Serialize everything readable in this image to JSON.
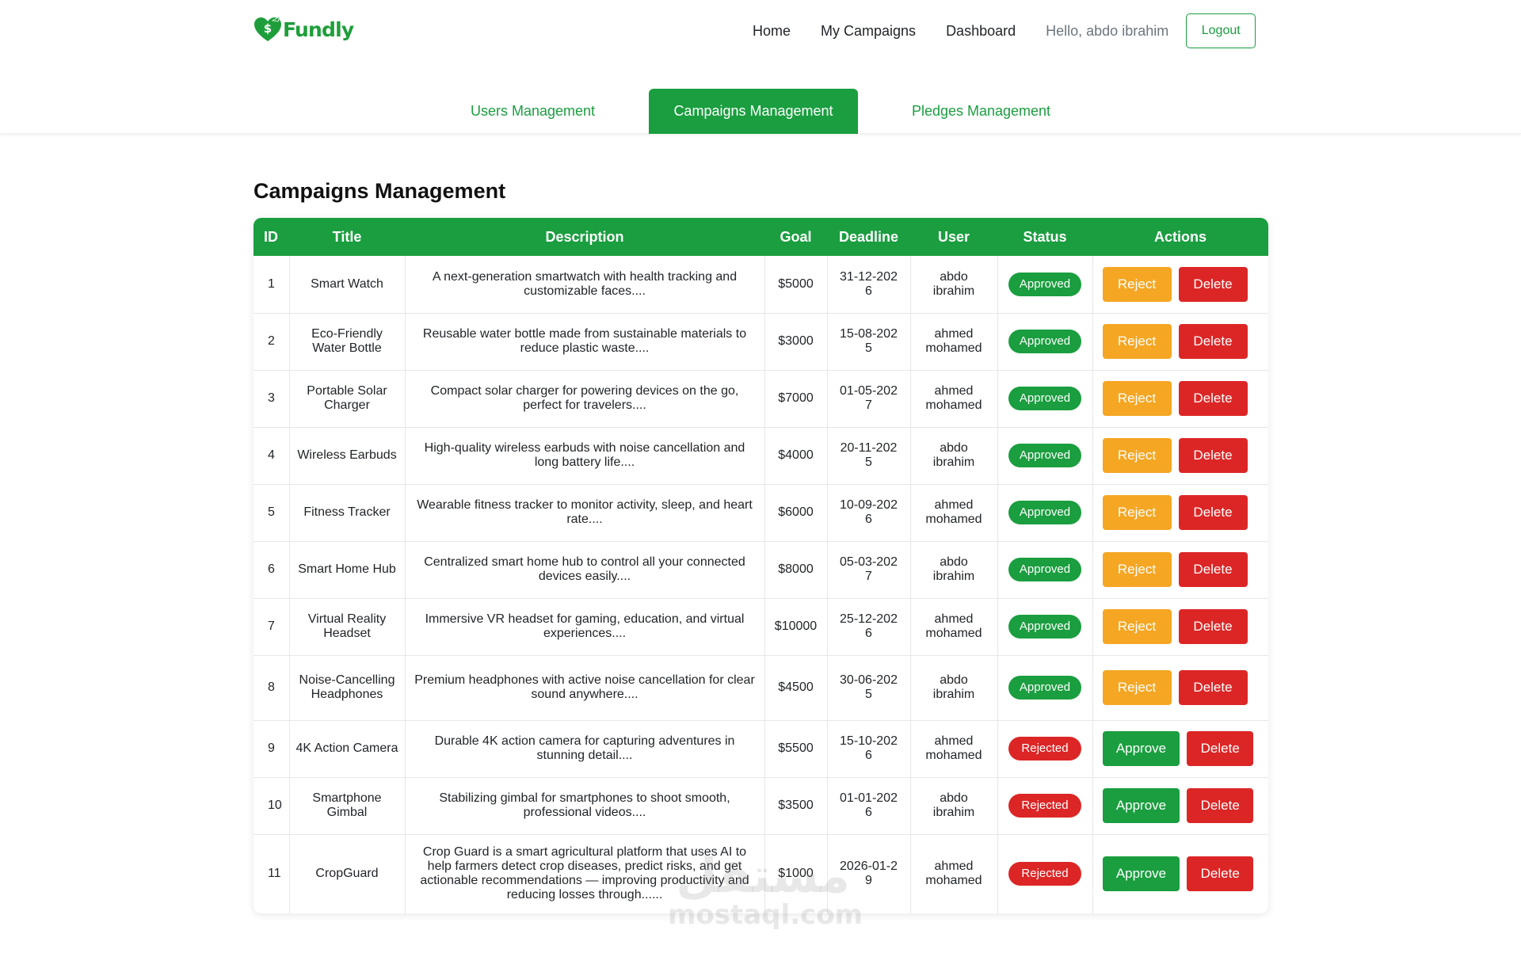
{
  "brand": {
    "name": "Fundly",
    "color": "#1e9e3a"
  },
  "nav": {
    "links": [
      "Home",
      "My Campaigns",
      "Dashboard"
    ],
    "greeting": "Hello, abdo ibrahim",
    "logout_label": "Logout"
  },
  "tabs": [
    {
      "label": "Users Management",
      "active": false
    },
    {
      "label": "Campaigns Management",
      "active": true
    },
    {
      "label": "Pledges Management",
      "active": false
    }
  ],
  "page_title": "Campaigns Management",
  "table": {
    "headers": [
      "ID",
      "Title",
      "Description",
      "Goal",
      "Deadline",
      "User",
      "Status",
      "Actions"
    ],
    "rows": [
      {
        "id": "1",
        "title": "Smart Watch",
        "description": "A next-generation smartwatch with health tracking and customizable faces....",
        "goal": "$5000",
        "deadline": "31-12-2026",
        "user": "abdo ibrahim",
        "status": "Approved",
        "actions": [
          "Reject",
          "Delete"
        ]
      },
      {
        "id": "2",
        "title": "Eco-Friendly Water Bottle",
        "description": "Reusable water bottle made from sustainable materials to reduce plastic waste....",
        "goal": "$3000",
        "deadline": "15-08-2025",
        "user": "ahmed mohamed",
        "status": "Approved",
        "actions": [
          "Reject",
          "Delete"
        ]
      },
      {
        "id": "3",
        "title": "Portable Solar Charger",
        "description": "Compact solar charger for powering devices on the go, perfect for travelers....",
        "goal": "$7000",
        "deadline": "01-05-2027",
        "user": "ahmed mohamed",
        "status": "Approved",
        "actions": [
          "Reject",
          "Delete"
        ]
      },
      {
        "id": "4",
        "title": "Wireless Earbuds",
        "description": "High-quality wireless earbuds with noise cancellation and long battery life....",
        "goal": "$4000",
        "deadline": "20-11-2025",
        "user": "abdo ibrahim",
        "status": "Approved",
        "actions": [
          "Reject",
          "Delete"
        ]
      },
      {
        "id": "5",
        "title": "Fitness Tracker",
        "description": "Wearable fitness tracker to monitor activity, sleep, and heart rate....",
        "goal": "$6000",
        "deadline": "10-09-2026",
        "user": "ahmed mohamed",
        "status": "Approved",
        "actions": [
          "Reject",
          "Delete"
        ]
      },
      {
        "id": "6",
        "title": "Smart Home Hub",
        "description": "Centralized smart home hub to control all your connected devices easily....",
        "goal": "$8000",
        "deadline": "05-03-2027",
        "user": "abdo ibrahim",
        "status": "Approved",
        "actions": [
          "Reject",
          "Delete"
        ]
      },
      {
        "id": "7",
        "title": "Virtual Reality Headset",
        "description": "Immersive VR headset for gaming, education, and virtual experiences....",
        "goal": "$10000",
        "deadline": "25-12-2026",
        "user": "ahmed mohamed",
        "status": "Approved",
        "actions": [
          "Reject",
          "Delete"
        ]
      },
      {
        "id": "8",
        "title": "Noise-Cancelling Headphones",
        "description": "Premium headphones with active noise cancellation for clear sound anywhere....",
        "goal": "$4500",
        "deadline": "30-06-2025",
        "user": "abdo ibrahim",
        "status": "Approved",
        "actions": [
          "Reject",
          "Delete"
        ]
      },
      {
        "id": "9",
        "title": "4K Action Camera",
        "description": "Durable 4K action camera for capturing adventures in stunning detail....",
        "goal": "$5500",
        "deadline": "15-10-2026",
        "user": "ahmed mohamed",
        "status": "Rejected",
        "actions": [
          "Approve",
          "Delete"
        ]
      },
      {
        "id": "10",
        "title": "Smartphone Gimbal",
        "description": "Stabilizing gimbal for smartphones to shoot smooth, professional videos....",
        "goal": "$3500",
        "deadline": "01-01-2026",
        "user": "abdo ibrahim",
        "status": "Rejected",
        "actions": [
          "Approve",
          "Delete"
        ]
      },
      {
        "id": "11",
        "title": "CropGuard",
        "description": "Crop Guard is a smart agricultural platform that uses AI to help farmers detect crop diseases, predict risks, and get actionable recommendations — improving productivity and reducing losses through......",
        "goal": "$1000",
        "deadline": "2026-01-29",
        "user": "ahmed mohamed",
        "status": "Rejected",
        "actions": [
          "Approve",
          "Delete"
        ]
      }
    ]
  },
  "watermark": {
    "arabic": "مستقل",
    "latin": "mostaql.com"
  },
  "colors": {
    "primary": "#1a9e3f",
    "warning": "#f5a623",
    "danger": "#dc2626",
    "muted": "#6c757d"
  }
}
